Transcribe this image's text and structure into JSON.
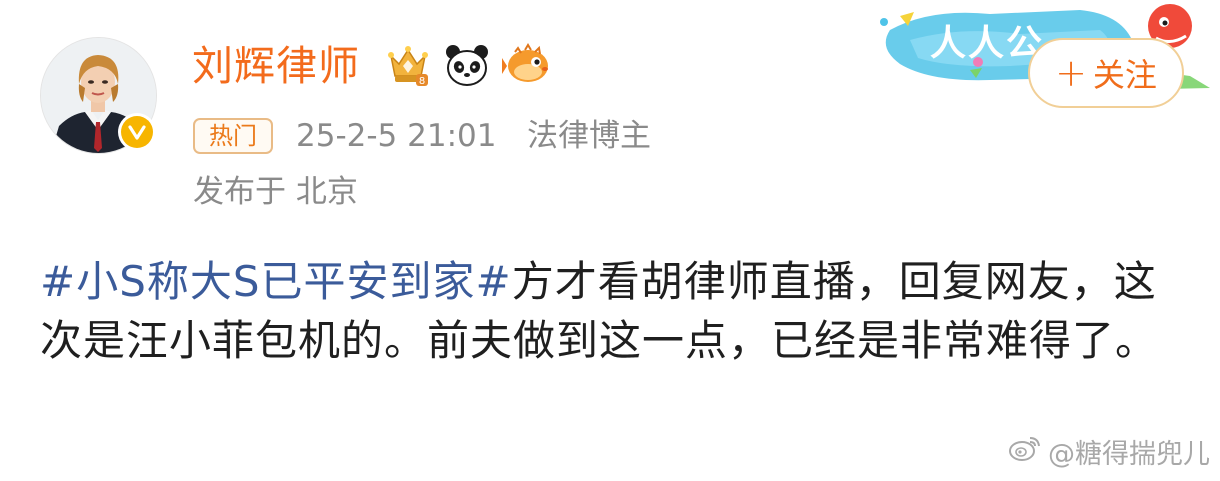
{
  "author": {
    "name": "刘辉律师",
    "avatar_icon": "lawyer-portrait",
    "verified_icon": "verified-v-icon",
    "badge_icons": [
      "crown-vip-icon",
      "panda-icon",
      "pufferfish-icon"
    ],
    "verified_color": "#f7b500",
    "name_color": "#f36b1c"
  },
  "meta": {
    "hot_tag": "热门",
    "time": "25-2-5 21:01",
    "role": "法律博主",
    "location": "发布于 北京"
  },
  "follow": {
    "plus": "+",
    "label": "关注"
  },
  "decoration": {
    "banner_text": "人人公"
  },
  "post": {
    "hashtag": "#小S称大S已平安到家#",
    "text": "方才看胡律师直播，回复网友，这次是汪小菲包机的。前夫做到这一点，已经是非常难得了。",
    "hashtag_color": "#3b5b9a"
  },
  "watermark": {
    "icon": "weibo-logo-icon",
    "text": "@糖得揣兜儿"
  }
}
